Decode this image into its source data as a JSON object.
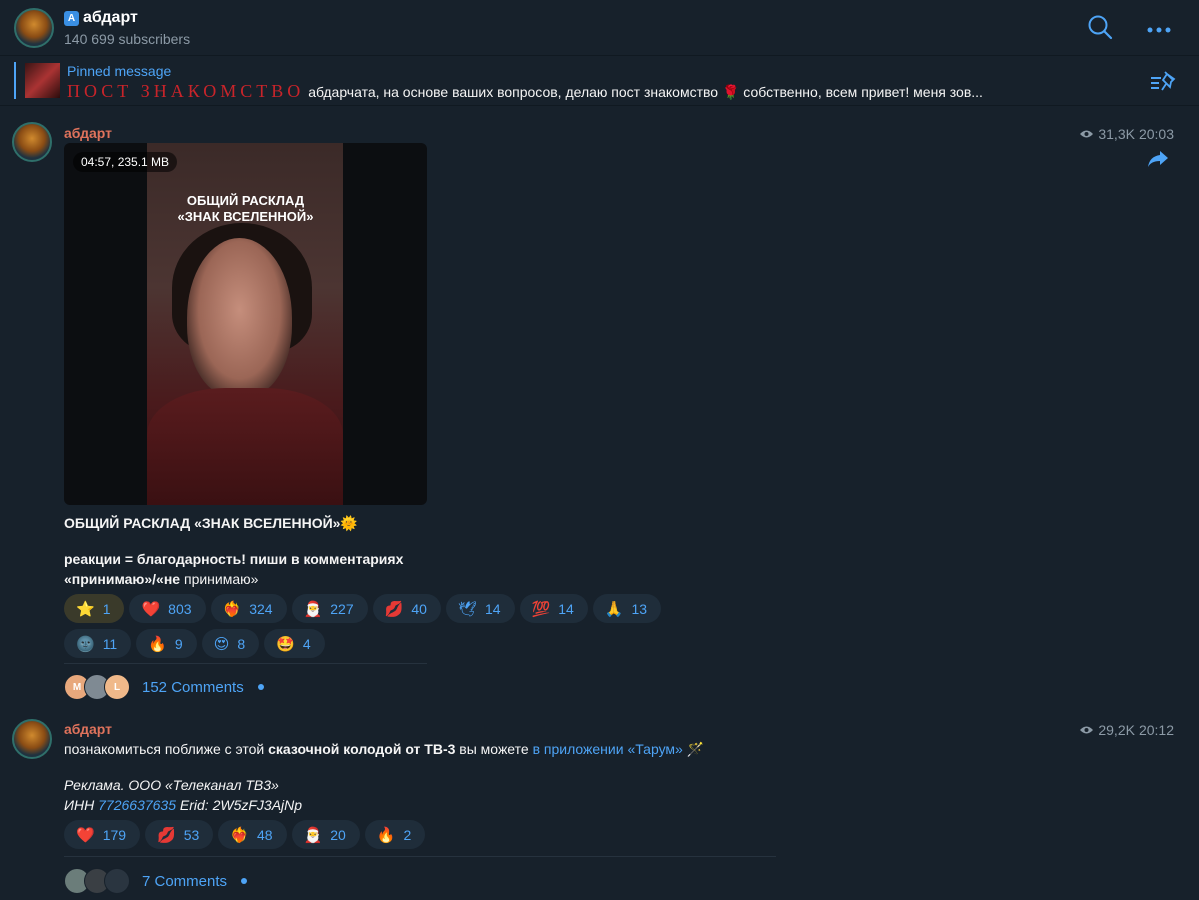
{
  "header": {
    "badge": "A",
    "title": "абдарт",
    "subscribers": "140 699 subscribers",
    "search_icon": "search-icon",
    "more_icon": "more-icon"
  },
  "pinned": {
    "label": "Pinned message",
    "red_title": "ПОСТ ЗНАКОМСТВО",
    "text_a": " абдарчата, на основе ваших вопросов, делаю пост знакомство ",
    "rose": "🌹",
    "text_b": " собственно, всем привет! меня зов..."
  },
  "post1": {
    "author": "абдарт",
    "views": "31,3K",
    "time": "20:03",
    "video_duration": "04:57, 235.1 MB",
    "video_caption_1": "ОБЩИЙ РАСКЛАД",
    "video_caption_2": "«ЗНАК ВСЕЛЕННОЙ»",
    "title": "ОБЩИЙ РАСКЛАД «ЗНАК ВСЕЛЕННОЙ»🌞",
    "body_bold": "реакции = благодарность! пиши в комментариях «принимаю»/«не",
    "body_normal": " принимаю»",
    "reactions": [
      {
        "emoji": "⭐",
        "count": "1"
      },
      {
        "emoji": "❤️",
        "count": "803"
      },
      {
        "emoji": "❤️‍🔥",
        "count": "324"
      },
      {
        "emoji": "🎅",
        "count": "227"
      },
      {
        "emoji": "💋",
        "count": "40"
      },
      {
        "emoji": "🕊",
        "count": "14"
      },
      {
        "emoji": "💯",
        "count": "14"
      },
      {
        "emoji": "🙏",
        "count": "13"
      },
      {
        "emoji": "🌚",
        "count": "11"
      },
      {
        "emoji": "🔥",
        "count": "9"
      },
      {
        "emoji": "😍",
        "count": "8"
      },
      {
        "emoji": "🤩",
        "count": "4"
      }
    ],
    "comment_avatars": [
      "M",
      "",
      "L"
    ],
    "comments": "152 Comments"
  },
  "post2": {
    "author": "абдарт",
    "views": "29,2K",
    "time": "20:12",
    "line1_a": "познакомиться поближе с этой ",
    "line1_b": "сказочной колодой от ТВ-3",
    "line1_c": " вы можете ",
    "line1_link": "в приложении «Тарум»",
    "line1_emoji": " 🪄",
    "ad_1": "Реклама. ООО «Телеканал ТВ3»",
    "ad_inn_label": "ИНН ",
    "ad_inn": "7726637635",
    "ad_erid": " Erid: 2W5zFJ3AjNp",
    "reactions": [
      {
        "emoji": "❤️",
        "count": "179"
      },
      {
        "emoji": "💋",
        "count": "53"
      },
      {
        "emoji": "❤️‍🔥",
        "count": "48"
      },
      {
        "emoji": "🎅",
        "count": "20"
      },
      {
        "emoji": "🔥",
        "count": "2"
      }
    ],
    "comments": "7 Comments"
  },
  "colors": {
    "background": "#17212b",
    "accent": "#4ea4f6",
    "author": "#e0735c",
    "reaction_bg": "#1f2d3a"
  }
}
